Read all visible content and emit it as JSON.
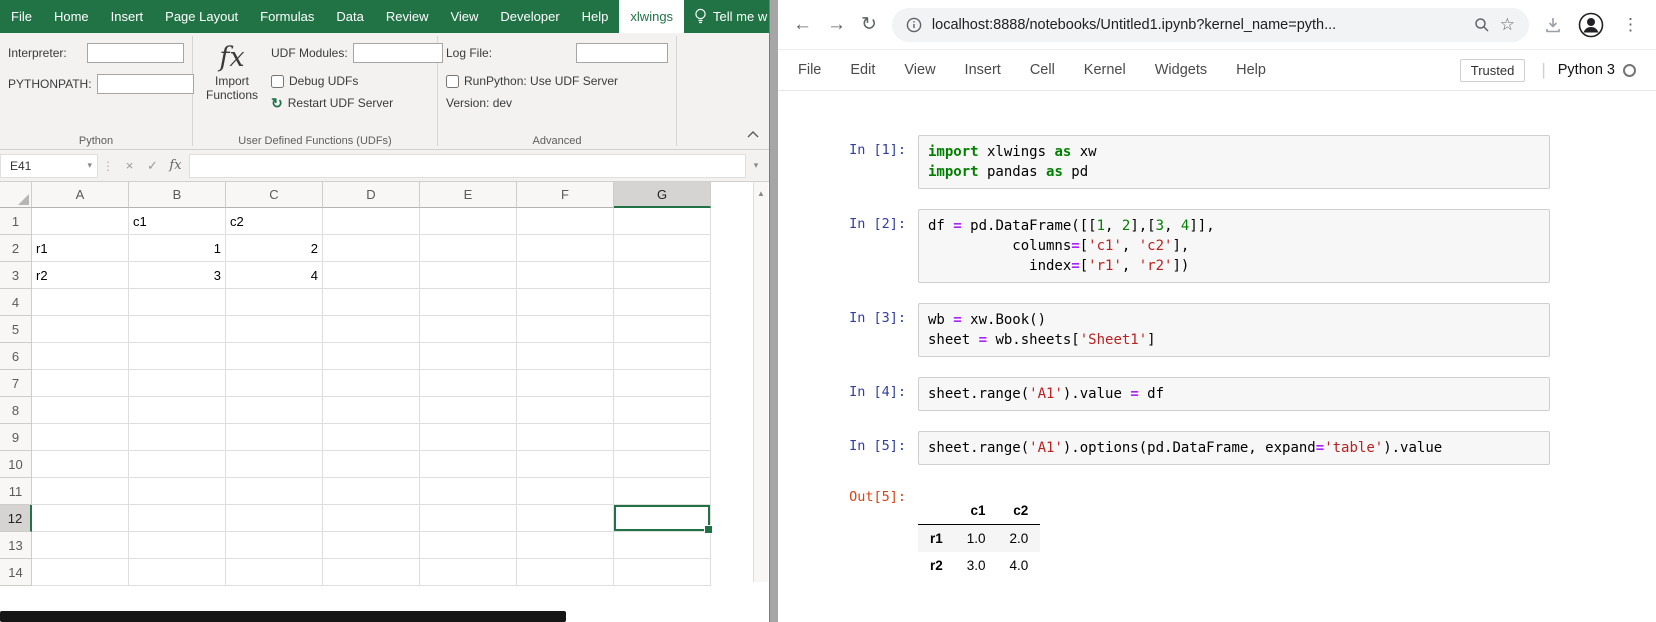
{
  "colors": {
    "excel_green": "#217346",
    "in_prompt": "#303F9F",
    "out_prompt": "#D84315",
    "keyword": "#008000",
    "number": "#008000",
    "string": "#BA2121",
    "operator": "#AA22FF"
  },
  "icons": {
    "dropdown": "▾",
    "vdots": "⋮",
    "cancel": "×",
    "enter": "✓",
    "fx": "fx",
    "refresh": "↻",
    "back": "←",
    "forward": "→",
    "reload": "↻",
    "star": "☆",
    "scroll_up": "▲",
    "kebab": "⋮",
    "pipe": "|"
  },
  "excel": {
    "menubar": {
      "items": [
        "File",
        "Home",
        "Insert",
        "Page Layout",
        "Formulas",
        "Data",
        "Review",
        "View",
        "Developer",
        "Help",
        "xlwings"
      ],
      "active": "xlwings",
      "tellme": "Tell me w"
    },
    "ribbon": {
      "interpreter_label": "Interpreter:",
      "pythonpath_label": "PYTHONPATH:",
      "python_group": "Python",
      "import_functions": "Import Functions",
      "udf_modules_label": "UDF Modules:",
      "debug_udfs": "Debug UDFs",
      "restart_udf": "Restart UDF Server",
      "udf_group": "User Defined Functions (UDFs)",
      "log_file_label": "Log File:",
      "runpython": "RunPython: Use UDF Server",
      "version": "Version: dev",
      "advanced_group": "Advanced"
    },
    "formula_bar": {
      "name_box": "E41"
    },
    "grid": {
      "columns": [
        "A",
        "B",
        "C",
        "D",
        "E",
        "F",
        "G"
      ],
      "row_count": 14,
      "cells": {
        "B1": "c1",
        "C1": "c2",
        "A2": "r1",
        "B2": "1",
        "C2": "2",
        "A3": "r2",
        "B3": "3",
        "C3": "4"
      },
      "selected": {
        "col": "G",
        "row": 12
      }
    }
  },
  "browser": {
    "url": "localhost:8888/notebooks/Untitled1.ipynb?kernel_name=pyth..."
  },
  "jupyter": {
    "menu": [
      "File",
      "Edit",
      "View",
      "Insert",
      "Cell",
      "Kernel",
      "Widgets",
      "Help"
    ],
    "trusted": "Trusted",
    "kernel": "Python 3",
    "cells": [
      {
        "kind": "code",
        "prompt": "In [1]:",
        "lines": [
          [
            [
              "kw",
              "import"
            ],
            [
              "tx",
              " xlwings "
            ],
            [
              "kw",
              "as"
            ],
            [
              "tx",
              " xw"
            ]
          ],
          [
            [
              "kw",
              "import"
            ],
            [
              "tx",
              " pandas "
            ],
            [
              "kw",
              "as"
            ],
            [
              "tx",
              " pd"
            ]
          ]
        ]
      },
      {
        "kind": "code",
        "prompt": "In [2]:",
        "lines": [
          [
            [
              "tx",
              "df "
            ],
            [
              "op",
              "="
            ],
            [
              "tx",
              " pd.DataFrame([["
            ],
            [
              "num",
              "1"
            ],
            [
              "tx",
              ", "
            ],
            [
              "num",
              "2"
            ],
            [
              "tx",
              "],["
            ],
            [
              "num",
              "3"
            ],
            [
              "tx",
              ", "
            ],
            [
              "num",
              "4"
            ],
            [
              "tx",
              "]],"
            ]
          ],
          [
            [
              "tx",
              "          columns"
            ],
            [
              "op",
              "="
            ],
            [
              "tx",
              "["
            ],
            [
              "str",
              "'c1'"
            ],
            [
              "tx",
              ", "
            ],
            [
              "str",
              "'c2'"
            ],
            [
              "tx",
              "],"
            ]
          ],
          [
            [
              "tx",
              "            index"
            ],
            [
              "op",
              "="
            ],
            [
              "tx",
              "["
            ],
            [
              "str",
              "'r1'"
            ],
            [
              "tx",
              ", "
            ],
            [
              "str",
              "'r2'"
            ],
            [
              "tx",
              "])"
            ]
          ]
        ]
      },
      {
        "kind": "code",
        "prompt": "In [3]:",
        "lines": [
          [
            [
              "tx",
              "wb "
            ],
            [
              "op",
              "="
            ],
            [
              "tx",
              " xw.Book()"
            ]
          ],
          [
            [
              "tx",
              "sheet "
            ],
            [
              "op",
              "="
            ],
            [
              "tx",
              " wb.sheets["
            ],
            [
              "str",
              "'Sheet1'"
            ],
            [
              "tx",
              "]"
            ]
          ]
        ]
      },
      {
        "kind": "code",
        "prompt": "In [4]:",
        "lines": [
          [
            [
              "tx",
              "sheet.range("
            ],
            [
              "str",
              "'A1'"
            ],
            [
              "tx",
              ").value "
            ],
            [
              "op",
              "="
            ],
            [
              "tx",
              " df"
            ]
          ]
        ]
      },
      {
        "kind": "code",
        "prompt": "In [5]:",
        "lines": [
          [
            [
              "tx",
              "sheet.range("
            ],
            [
              "str",
              "'A1'"
            ],
            [
              "tx",
              ").options(pd.DataFrame, expand"
            ],
            [
              "op",
              "="
            ],
            [
              "str",
              "'table'"
            ],
            [
              "tx",
              ").value"
            ]
          ]
        ]
      },
      {
        "kind": "output",
        "prompt": "Out[5]:",
        "table": {
          "columns": [
            "c1",
            "c2"
          ],
          "rows": [
            {
              "index": "r1",
              "values": [
                "1.0",
                "2.0"
              ]
            },
            {
              "index": "r2",
              "values": [
                "3.0",
                "4.0"
              ]
            }
          ]
        }
      }
    ]
  }
}
